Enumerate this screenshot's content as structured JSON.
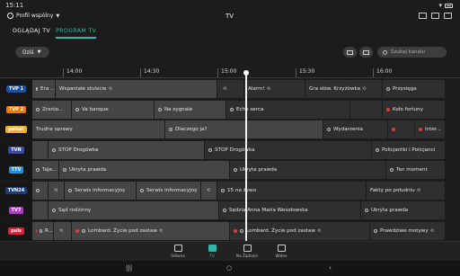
{
  "status": {
    "time": "15:11"
  },
  "header": {
    "profile_label": "Profil wspólny",
    "title": "TV"
  },
  "tabs": [
    {
      "label": "OGLĄDAJ TV"
    },
    {
      "label": "PROGRAM TV"
    }
  ],
  "controls": {
    "day_label": "Dziś",
    "search_placeholder": "Szukaj kanału"
  },
  "timeline": [
    "14:00",
    "14:30",
    "15:00",
    "15:30",
    "16:00"
  ],
  "channels": [
    {
      "logo": "TVP 1",
      "logo_color": "#1d4fa8",
      "programs": [
        {
          "title": "Era ...",
          "start": 36,
          "width": 26,
          "past": true,
          "info": true
        },
        {
          "title": "Wspaniałe stulecie",
          "start": 62,
          "width": 180,
          "past": true,
          "rec": true
        },
        {
          "title": "",
          "start": 242,
          "width": 30,
          "past": false,
          "rec": true
        },
        {
          "title": "Alarm!",
          "start": 272,
          "width": 68,
          "past": false,
          "rec": true
        },
        {
          "title": "Gra słów. Krzyżówka",
          "start": 340,
          "width": 86,
          "past": false,
          "rec": true
        },
        {
          "title": "Przysięga",
          "start": 426,
          "width": 70,
          "past": false,
          "info": true
        }
      ]
    },
    {
      "logo": "TVP 2",
      "logo_color": "#e87b12",
      "programs": [
        {
          "title": "Zranio...",
          "start": 36,
          "width": 44,
          "past": true,
          "info": true
        },
        {
          "title": "Va banque",
          "start": 80,
          "width": 92,
          "past": true,
          "info": true
        },
        {
          "title": "Na sygnale",
          "start": 172,
          "width": 80,
          "past": true,
          "info": true
        },
        {
          "title": "Echo serca",
          "start": 252,
          "width": 138,
          "past": false,
          "info": true
        },
        {
          "title": "",
          "start": 390,
          "width": 36,
          "past": false
        },
        {
          "title": "Koło fortuny",
          "start": 426,
          "width": 70,
          "past": false,
          "dot": true
        }
      ]
    },
    {
      "logo": "polsat",
      "logo_color": "#f2b31a",
      "programs": [
        {
          "title": "Trudne sprawy",
          "start": 36,
          "width": 148,
          "past": true
        },
        {
          "title": "Dlaczego ja?",
          "start": 184,
          "width": 176,
          "past": true,
          "info": true
        },
        {
          "title": "Wydarzenia",
          "start": 360,
          "width": 72,
          "past": false,
          "info": true
        },
        {
          "title": "",
          "start": 432,
          "width": 30,
          "past": false,
          "dot": true
        },
        {
          "title": "Inter...",
          "start": 462,
          "width": 34,
          "past": false,
          "dot": true
        }
      ]
    },
    {
      "logo": "TVN",
      "logo_color": "#3b4aa0",
      "programs": [
        {
          "title": "",
          "start": 36,
          "width": 18,
          "past": true
        },
        {
          "title": "STOP Drogówka",
          "start": 54,
          "width": 174,
          "past": true,
          "info": true
        },
        {
          "title": "STOP Drogówka",
          "start": 228,
          "width": 186,
          "past": false,
          "info": true
        },
        {
          "title": "Policjantki i Policjanci",
          "start": 414,
          "width": 82,
          "past": false,
          "info": true
        }
      ]
    },
    {
      "logo": "TTV",
      "logo_color": "#2a8fd1",
      "programs": [
        {
          "title": "Taje...",
          "start": 36,
          "width": 30,
          "past": true,
          "info": true
        },
        {
          "title": "Ukryta prawda",
          "start": 66,
          "width": 190,
          "past": true,
          "info": true
        },
        {
          "title": "Ukryta prawda",
          "start": 256,
          "width": 174,
          "past": false,
          "info": true
        },
        {
          "title": "Ten moment",
          "start": 430,
          "width": 66,
          "past": false,
          "info": true
        }
      ]
    },
    {
      "logo": "TVN24",
      "logo_color": "#1a3a7a",
      "programs": [
        {
          "title": "",
          "start": 36,
          "width": 18,
          "past": true,
          "info": true
        },
        {
          "title": "",
          "start": 54,
          "width": 18,
          "past": true,
          "rec": true
        },
        {
          "title": "Serwis informacyjny",
          "start": 72,
          "width": 80,
          "past": true,
          "info": true
        },
        {
          "title": "Serwis informacyjny",
          "start": 152,
          "width": 72,
          "past": true,
          "info": true
        },
        {
          "title": "",
          "start": 224,
          "width": 18,
          "past": true,
          "rec": true
        },
        {
          "title": "15 na żywo",
          "start": 242,
          "width": 166,
          "past": false,
          "info": true
        },
        {
          "title": "Fakty po południu",
          "start": 408,
          "width": 88,
          "past": false,
          "rec": true
        }
      ]
    },
    {
      "logo": "TV7",
      "logo_color": "#b03cc8",
      "programs": [
        {
          "title": "",
          "start": 36,
          "width": 18,
          "past": true
        },
        {
          "title": "Sąd rodzinny",
          "start": 54,
          "width": 190,
          "past": true,
          "info": true
        },
        {
          "title": "Sędzia Anna Maria Wesołowska",
          "start": 244,
          "width": 158,
          "past": false,
          "info": true
        },
        {
          "title": "Ukryta prawda",
          "start": 402,
          "width": 94,
          "past": false,
          "info": true
        }
      ]
    },
    {
      "logo": "puls",
      "logo_color": "#d4283a",
      "programs": [
        {
          "title": "R...",
          "start": 36,
          "width": 24,
          "past": true,
          "info": true,
          "dot": true
        },
        {
          "title": "",
          "start": 60,
          "width": 20,
          "past": true,
          "rec": true
        },
        {
          "title": "Lombard. Życie pod zastaw",
          "start": 80,
          "width": 176,
          "past": true,
          "info": true,
          "dot": true,
          "rec": true
        },
        {
          "title": "Lombard. Życie pod zastaw",
          "start": 256,
          "width": 156,
          "past": false,
          "info": true,
          "dot": true,
          "rec": true
        },
        {
          "title": "Prawdziwe motywy",
          "start": 412,
          "width": 84,
          "past": false,
          "info": true,
          "rec": true
        }
      ]
    }
  ],
  "bottom_nav": [
    {
      "label": "Główna",
      "icon": "home-icon",
      "active": false
    },
    {
      "label": "TV",
      "icon": "tv-icon",
      "active": true
    },
    {
      "label": "Na Żądanie",
      "icon": "film-icon",
      "active": false
    },
    {
      "label": "Wideo",
      "icon": "folder-icon",
      "active": false
    }
  ],
  "system_nav": {
    "recents": "|||",
    "home": "○",
    "back": "‹"
  },
  "colors": {
    "accent": "#2fb8a8",
    "now_marker": "#f0f0f0"
  }
}
